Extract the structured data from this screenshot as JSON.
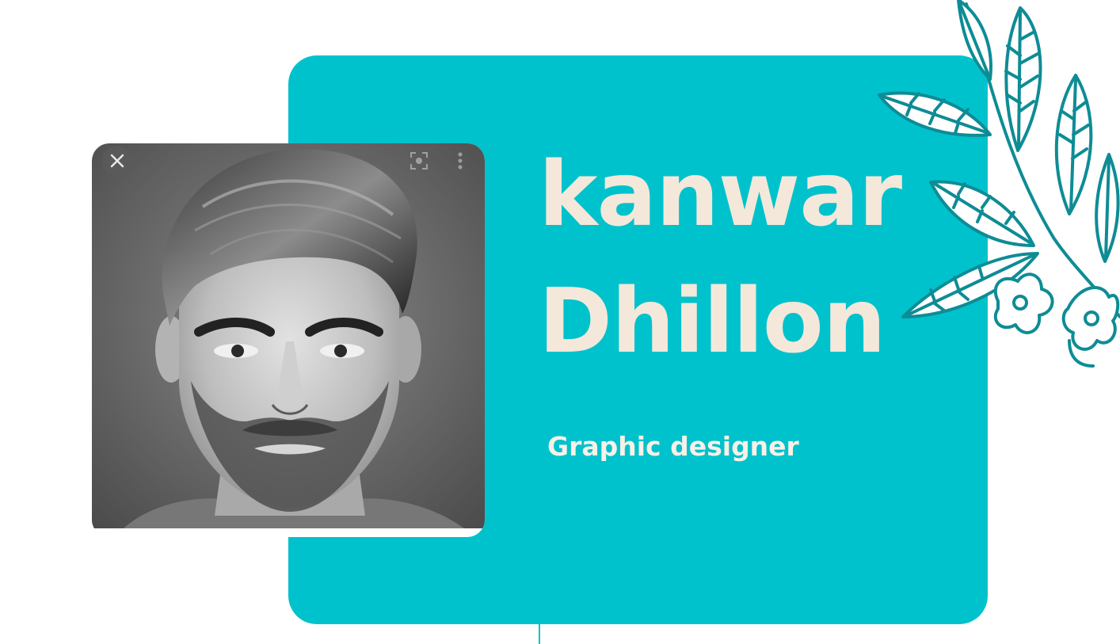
{
  "profile": {
    "first_name": "kanwar",
    "last_name": "Dhillon",
    "role": "Graphic designer"
  },
  "photo": {
    "controls": {
      "close_icon": "close-icon",
      "lens_icon": "lens-icon",
      "more_icon": "more-vertical-icon"
    }
  },
  "decor": {
    "leaf_icon": "leaf-branch-illustration"
  },
  "colors": {
    "card_teal": "#00C2CC",
    "name_cream": "#F4E8DA",
    "leaf_stroke": "#0E8C95",
    "background": "#FFFFFF"
  }
}
